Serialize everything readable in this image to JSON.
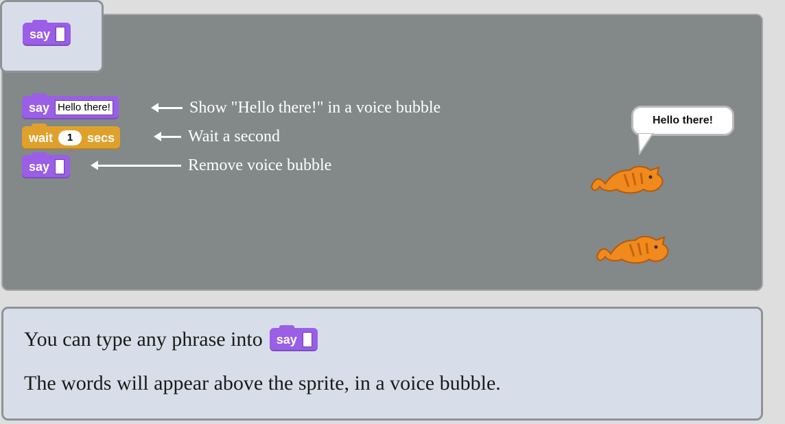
{
  "palette": {
    "say_block": {
      "label": "say",
      "value": ""
    }
  },
  "script": {
    "say_block": {
      "label": "say",
      "value": "Hello there!"
    },
    "wait_block": {
      "label": "wait",
      "value": "1",
      "unit": "secs"
    },
    "say_empty_block": {
      "label": "say",
      "value": ""
    }
  },
  "annotations": {
    "say": "Show \"Hello there!\" in a voice bubble",
    "wait": "Wait a second",
    "say_empty": "Remove voice bubble"
  },
  "stage": {
    "speech_bubble": "Hello there!"
  },
  "info": {
    "line1_text": "You can type any phrase into",
    "inline_block": {
      "label": "say",
      "value": ""
    },
    "line2_text": "The words will appear above the sprite, in a voice bubble."
  },
  "colors": {
    "looks_block": "#9a5fe6",
    "control_block": "#e0a12c",
    "stage_bg": "#838889",
    "card_bg": "#d8dee9"
  }
}
